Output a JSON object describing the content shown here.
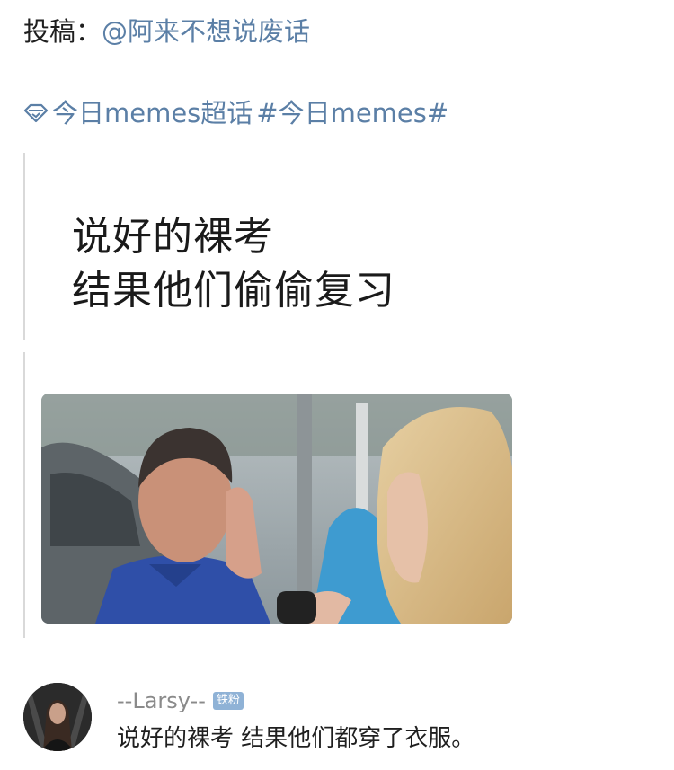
{
  "post": {
    "submit_prefix": "投稿：",
    "submitter": "@阿来不想说废话",
    "topic_super": "今日memes超话",
    "topic_hashtag": "#今日memes#"
  },
  "meme": {
    "caption_line1": "说好的裸考",
    "caption_line2": "结果他们偷偷复习"
  },
  "comment": {
    "username": "--Larsy--",
    "badge": "铁粉",
    "text": "说好的裸考 结果他们都穿了衣服。"
  },
  "icons": {
    "topic": "supertopic-diamond-icon"
  },
  "colors": {
    "link": "#5b7fa6",
    "badge": "#8fb2d6",
    "text": "#1f1f1f",
    "muted": "#8a8a8a"
  }
}
